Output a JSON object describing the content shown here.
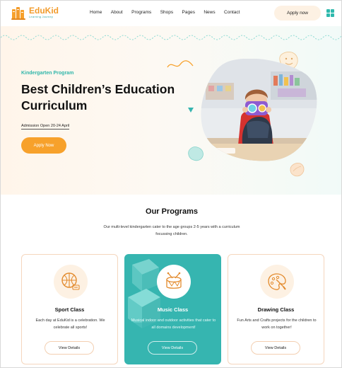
{
  "brand": {
    "name": "EduKid",
    "tagline": "Learning Journey",
    "colors": {
      "orange": "#f7a12b",
      "teal": "#36b5b0",
      "cream": "#fdf1e3"
    }
  },
  "nav": {
    "items": [
      "Home",
      "About",
      "Programs",
      "Shops",
      "Pages",
      "News",
      "Contact"
    ],
    "apply_label": "Apply now",
    "menu_icon": "grid-icon"
  },
  "hero": {
    "kicker": "Kindergarten Program",
    "title": "Best Children’s Education Curriculum",
    "admission": "Admission Open 20-24 April",
    "apply_label": "Apply Now"
  },
  "programs": {
    "title": "Our Programs",
    "subtitle": "Our multi-level kindergarten cater to the age groups 2-5 years with a curriculum focussing children.",
    "cards": [
      {
        "title": "Sport Class",
        "description": "Each day at EduKid is a celebration. We celebrate all sports!",
        "button": "View Details",
        "icon": "basketball-icon",
        "active": false
      },
      {
        "title": "Music Class",
        "description": "Musical indoor and outdoor activities that cater to all domains development!",
        "button": "View Details",
        "icon": "drum-icon",
        "active": true
      },
      {
        "title": "Drawing Class",
        "description": "Fun Arts and Crafts projects for the children to work on together!",
        "button": "View Details",
        "icon": "palette-icon",
        "active": false
      }
    ]
  }
}
